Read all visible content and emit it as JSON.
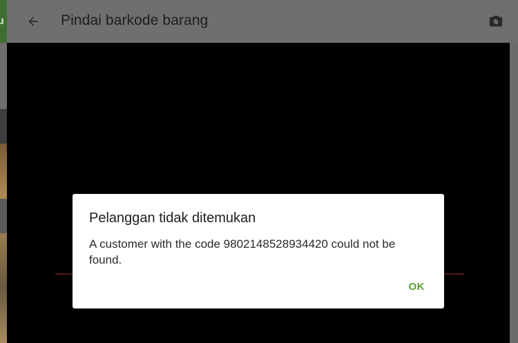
{
  "appbar": {
    "title": "Pindai barkode barang",
    "back_icon": "arrow-left-icon",
    "camera_icon": "camera-switch-icon"
  },
  "underlay": {
    "partial_text": "u"
  },
  "dialog": {
    "title": "Pelanggan tidak ditemukan",
    "message": "A customer with the code 9802148528934420 could not be found.",
    "ok_label": "OK"
  },
  "colors": {
    "accent": "#5aa02c",
    "viewport": "#000000",
    "appbar": "#6f6f6f"
  }
}
